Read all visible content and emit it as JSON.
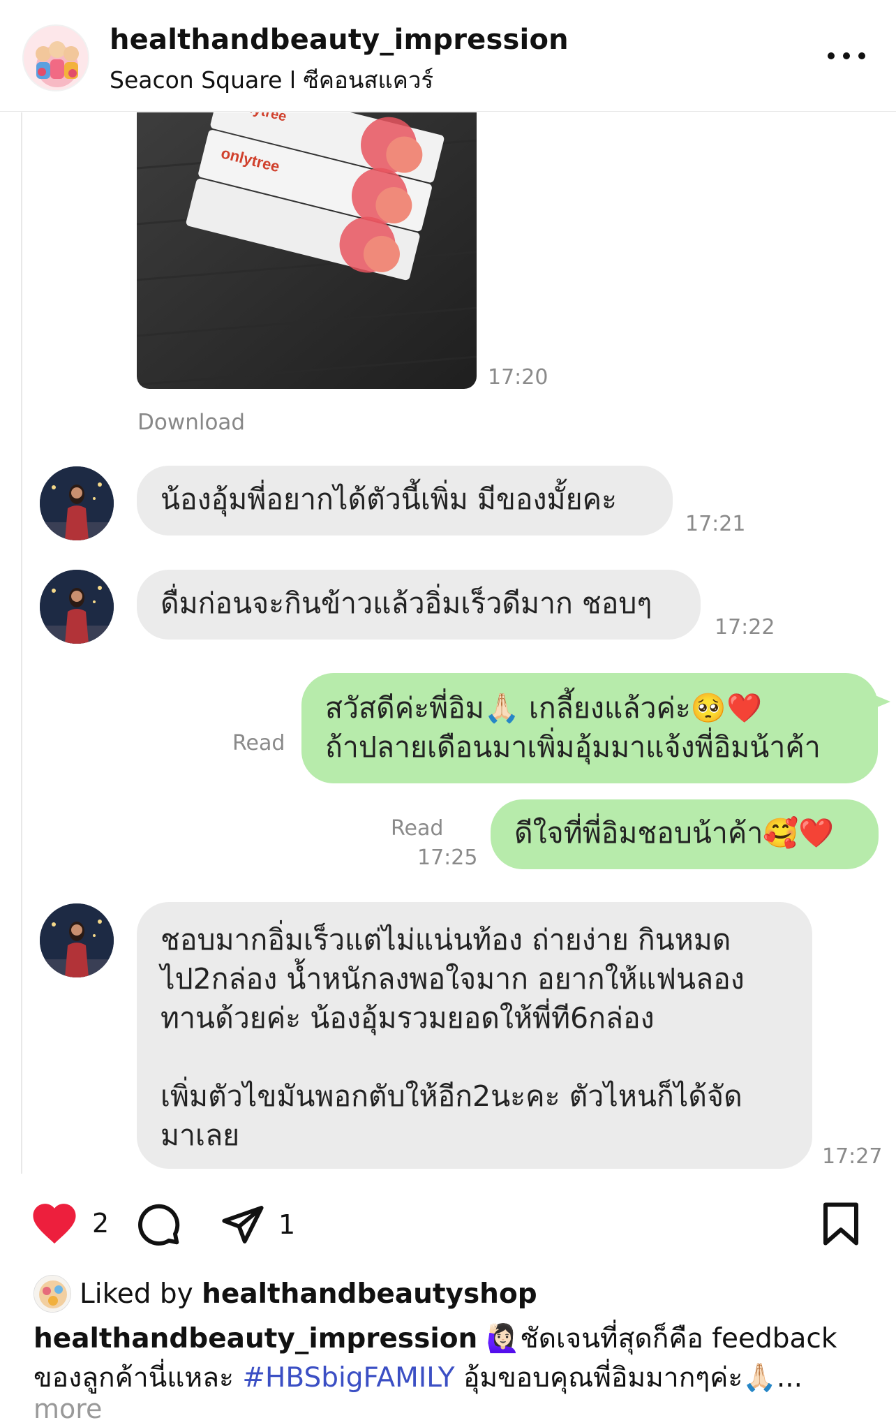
{
  "header": {
    "username": "healthandbeauty_impression",
    "location": "Seacon Square l ซีคอนสแควร์"
  },
  "chat": {
    "photo_time": "17:20",
    "download_label": "Download",
    "product_brand": "onlytree",
    "messages": [
      {
        "side": "in",
        "lines": [
          "น้องอุ้มพี่อยากได้ตัวนี้เพิ่ม มีของมั้ยคะ"
        ],
        "time": "17:21"
      },
      {
        "side": "in",
        "lines": [
          "ดื่มก่อนจะกินข้าวแล้วอิ่มเร็วดีมาก ชอบๆ"
        ],
        "time": "17:22"
      },
      {
        "side": "out",
        "lines": [
          "สวัสดีค่ะพี่อิม🙏🏻 เกลี้ยงแล้วค่ะ🥺❤️",
          "ถ้าปลายเดือนมาเพิ่มอุ้มมาแจ้งพี่อิมน้าค้า"
        ],
        "read": "Read",
        "time": ""
      },
      {
        "side": "out",
        "lines": [
          "ดีใจที่พี่อิมชอบน้าค้า🥰❤️"
        ],
        "read": "Read",
        "time": "17:25"
      },
      {
        "side": "in",
        "lines": [
          "ชอบมากอิ่มเร็วแต่ไม่แน่นท้อง ถ่ายง่าย กินหมด",
          "ไป2กล่อง น้ำหนักลงพอใจมาก อยากให้แฟนลอง",
          "ทานด้วยค่ะ  น้องอุ้มรวมยอดให้พี่ที6กล่อง",
          "",
          "เพิ่มตัวไขมันพอกตับให้อีก2นะคะ ตัวไหนก็ได้จัด",
          "มาเลย"
        ],
        "time": "17:27"
      }
    ]
  },
  "actions": {
    "like_count": "2",
    "share_count": "1",
    "like_color": "#ed1f3d"
  },
  "caption": {
    "liked_prefix": "Liked by ",
    "liked_user": "healthandbeautyshop",
    "user": "healthandbeauty_impression",
    "text1": " 🙋🏻‍♀️ชัดเจนที่สุดก็คือ feedback",
    "text2": "ของลูกค้านี่แหละ ",
    "hashtag": "#HBSbigFAMILY",
    "text3": " อุ้มขอบคุณพี่อิมมากๆค่ะ🙏🏻...",
    "more": "more"
  },
  "colors": {
    "incoming_bubble": "#ebebeb",
    "outgoing_bubble": "#b7ebab",
    "hashtag": "#3b4fc4"
  }
}
